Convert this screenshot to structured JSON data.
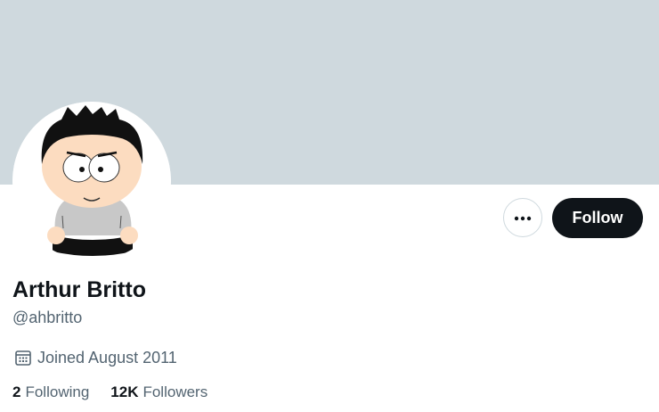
{
  "profile": {
    "display_name": "Arthur Britto",
    "handle": "@ahbritto",
    "joined": "Joined August 2011",
    "following_count": "2",
    "following_label": "Following",
    "followers_count": "12K",
    "followers_label": "Followers"
  },
  "actions": {
    "follow_label": "Follow",
    "more_icon": "more-horizontal-icon"
  },
  "icons": {
    "joined": "calendar-icon"
  },
  "colors": {
    "banner": "#cfd9de",
    "primary_text": "#0f1419",
    "secondary_text": "#536471",
    "follow_button_bg": "#0f1419",
    "follow_button_text": "#ffffff",
    "border": "#cfd9de"
  }
}
